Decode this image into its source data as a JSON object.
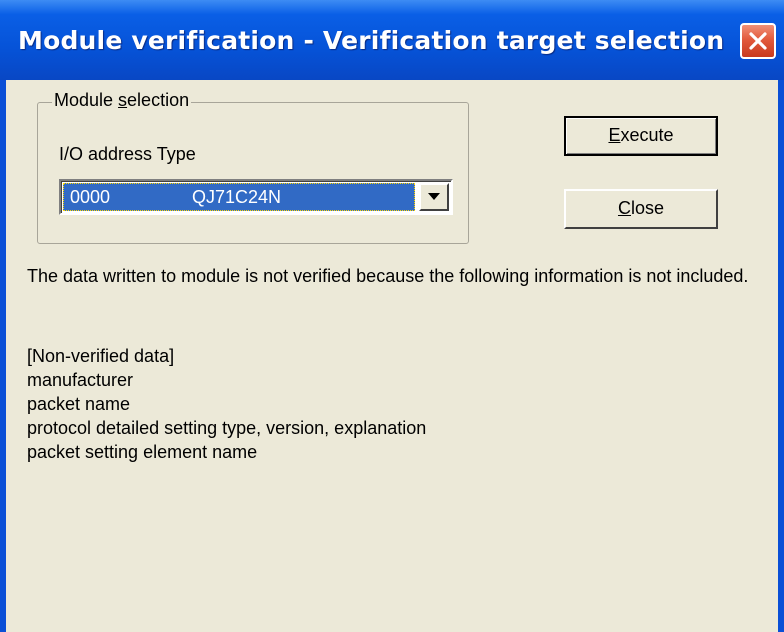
{
  "window": {
    "title": "Module verification - Verification target selection"
  },
  "module_selection": {
    "legend_prefix": "Module ",
    "legend_mnemonic": "s",
    "legend_suffix": "election",
    "column_header": "I/O address Type",
    "selected": {
      "io_address": "0000",
      "type": "QJ71C24N"
    }
  },
  "buttons": {
    "execute": {
      "mnemonic": "E",
      "rest": "xecute"
    },
    "close": {
      "mnemonic": "C",
      "rest": "lose"
    }
  },
  "message": "The data written to module is not verified because the following information is not included.",
  "non_verified": {
    "heading": "[Non-verified data]",
    "items": [
      "manufacturer",
      "packet name",
      "protocol detailed setting type, version, explanation",
      "packet setting element name"
    ]
  },
  "colors": {
    "title_bar": "#0653d8",
    "dialog_background": "#ece9d8",
    "selection": "#316ac5",
    "close_button": "#e25a3c"
  },
  "icons": {
    "close": "close-x-icon",
    "dropdown": "chevron-down-icon"
  }
}
